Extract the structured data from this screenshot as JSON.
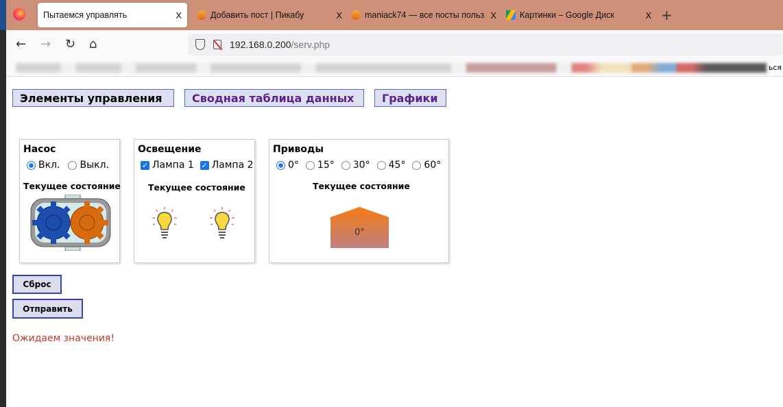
{
  "browser": {
    "tabs": [
      {
        "title": "Пытаемся управлять",
        "active": true
      },
      {
        "title": "Добавить пост | Пикабу"
      },
      {
        "title": "maniack74 — все посты польз"
      },
      {
        "title": "Картинки – Google Диск"
      }
    ],
    "close_glyph": "X",
    "new_tab": "+",
    "url_host": "192.168.0.200",
    "url_path": "/serv.php",
    "bookmarks_end": "ься"
  },
  "nav": {
    "controls": "Элементы управления",
    "summary": "Сводная таблица данных",
    "charts": "Графики"
  },
  "pump": {
    "title": "Насос",
    "on": "Вкл.",
    "off": "Выкл.",
    "selected": "on",
    "state_label": "Текущее состояние"
  },
  "lighting": {
    "title": "Освещение",
    "lamp1": "Лампа 1",
    "lamp2": "Лампа 2",
    "lamp1_checked": true,
    "lamp2_checked": true,
    "state_label": "Текущее состояние"
  },
  "drives": {
    "title": "Приводы",
    "angles": [
      "0°",
      "15°",
      "30°",
      "45°",
      "60°"
    ],
    "selected": "0°",
    "state_label": "Текущее состояние",
    "current": "0°"
  },
  "buttons": {
    "reset": "Сброс",
    "send": "Отправить"
  },
  "status": "Ожидаем значения!",
  "colors": {
    "tabbar": "#cf907a",
    "button_border": "#5566cc",
    "status": "#c0392b",
    "link": "#5b1f8e"
  }
}
